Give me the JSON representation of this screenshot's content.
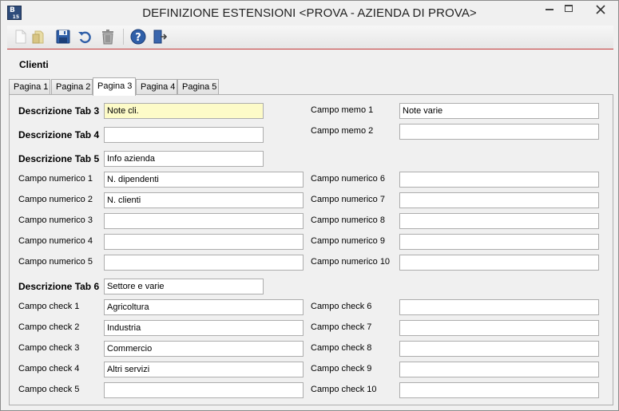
{
  "window": {
    "title": "DEFINIZIONE ESTENSIONI <PROVA - AZIENDA DI PROVA>",
    "icon_text": "B",
    "icon_sub": "15"
  },
  "toolbar": {
    "buttons": [
      "new-document-icon",
      "open-folder-icon",
      "save-icon",
      "undo-icon",
      "delete-trash-icon",
      "help-icon",
      "exit-door-icon"
    ]
  },
  "section_title": "Clienti",
  "tabs": [
    {
      "label": "Pagina 1",
      "active": false
    },
    {
      "label": "Pagina 2",
      "active": false
    },
    {
      "label": "Pagina 3",
      "active": true
    },
    {
      "label": "Pagina 4",
      "active": false
    },
    {
      "label": "Pagina 5",
      "active": false
    }
  ],
  "form": {
    "tab3": {
      "label": "Descrizione Tab 3",
      "value": "Note cli."
    },
    "tab4": {
      "label": "Descrizione Tab 4",
      "value": ""
    },
    "tab5": {
      "label": "Descrizione Tab 5",
      "value": "Info azienda"
    },
    "tab6": {
      "label": "Descrizione Tab 6",
      "value": "Settore e varie"
    },
    "memo": [
      {
        "label": "Campo memo 1",
        "value": "Note varie"
      },
      {
        "label": "Campo memo 2",
        "value": ""
      }
    ],
    "numerici_left": [
      {
        "label": "Campo numerico 1",
        "value": "N. dipendenti"
      },
      {
        "label": "Campo numerico 2",
        "value": "N. clienti"
      },
      {
        "label": "Campo numerico 3",
        "value": ""
      },
      {
        "label": "Campo numerico 4",
        "value": ""
      },
      {
        "label": "Campo numerico 5",
        "value": ""
      }
    ],
    "numerici_right": [
      {
        "label": "Campo numerico 6",
        "value": ""
      },
      {
        "label": "Campo numerico 7",
        "value": ""
      },
      {
        "label": "Campo numerico 8",
        "value": ""
      },
      {
        "label": "Campo numerico 9",
        "value": ""
      },
      {
        "label": "Campo numerico 10",
        "value": ""
      }
    ],
    "check_left": [
      {
        "label": "Campo check 1",
        "value": "Agricoltura"
      },
      {
        "label": "Campo check 2",
        "value": "Industria"
      },
      {
        "label": "Campo check 3",
        "value": "Commercio"
      },
      {
        "label": "Campo check 4",
        "value": "Altri servizi"
      },
      {
        "label": "Campo check 5",
        "value": ""
      }
    ],
    "check_right": [
      {
        "label": "Campo check 6",
        "value": ""
      },
      {
        "label": "Campo check 7",
        "value": ""
      },
      {
        "label": "Campo check 8",
        "value": ""
      },
      {
        "label": "Campo check 9",
        "value": ""
      },
      {
        "label": "Campo check 10",
        "value": ""
      }
    ]
  },
  "colors": {
    "highlight_field": "#fdfbc8",
    "toolbar_accent": "#c53a3a"
  }
}
